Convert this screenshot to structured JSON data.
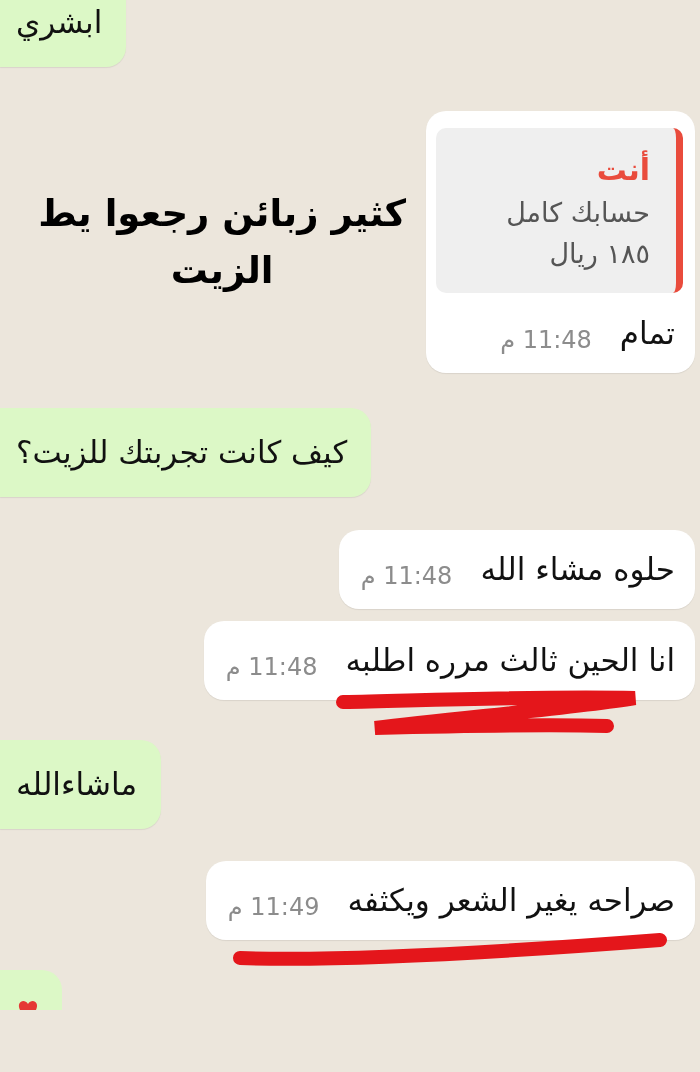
{
  "messages": [
    {
      "kind": "received",
      "text": "ابشري",
      "underlined": false
    },
    {
      "kind": "sent",
      "quote": {
        "author": "أنت",
        "lines": [
          "حسابك كامل",
          "١٨٥ ريال"
        ]
      },
      "text": "تمام",
      "time": "11:48 م",
      "underlined": false,
      "caption": [
        "كثير زبائن رجعوا يط",
        "الزيت"
      ]
    },
    {
      "kind": "received",
      "text": "كيف كانت تجربتك للزيت؟",
      "underlined": false
    },
    {
      "kind": "sent",
      "text": "حلوه مشاء الله",
      "time": "11:48 م",
      "underlined": false
    },
    {
      "kind": "sent",
      "text": "انا الحين ثالث مرره اطلبه",
      "time": "11:48 م",
      "underlined": true
    },
    {
      "kind": "received",
      "text": "ماشاءالله",
      "underlined": false
    },
    {
      "kind": "sent",
      "text": "صراحه يغير الشعر ويكثفه",
      "time": "11:49 م",
      "underlined": true
    },
    {
      "kind": "received_partial"
    }
  ]
}
